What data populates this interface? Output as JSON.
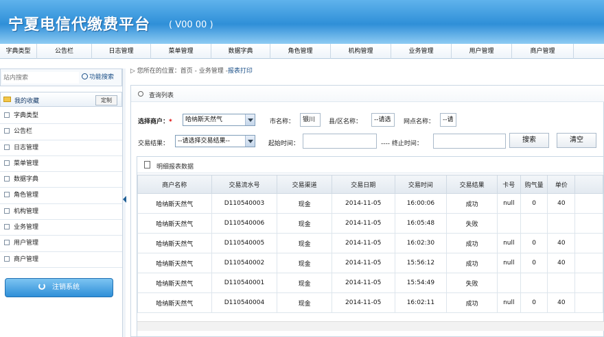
{
  "header": {
    "title": "宁夏电信代缴费平台",
    "version": "( V00 00 )"
  },
  "topnav": [
    "字典类型",
    "公告栏",
    "日志管理",
    "菜单管理",
    "数据字典",
    "角色管理",
    "机构管理",
    "业务管理",
    "用户管理",
    "商户管理"
  ],
  "sidebar": {
    "search_placeholder": "站内搜索",
    "search_button": "功能搜索",
    "favorites_label": "我的收藏",
    "define_button": "定制",
    "items": [
      "字典类型",
      "公告栏",
      "日志管理",
      "菜单管理",
      "数据字典",
      "角色管理",
      "机构管理",
      "业务管理",
      "用户管理",
      "商户管理"
    ],
    "logout_label": "注销系统"
  },
  "breadcrumb": {
    "prefix": "您所在的位置：首页 - 业务管理 -",
    "current": "报表打印"
  },
  "query": {
    "panel_title": "查询列表",
    "merchant_label": "选择商户：",
    "merchant_value": "哈纳斯天然气",
    "city_label": "市名称：",
    "city_value": "银川",
    "district_label": "县/区名称：",
    "district_value": "--请选",
    "outlet_label": "网点名称：",
    "outlet_value": "--请",
    "result_label": "交易结果：",
    "result_value": "--请选择交易结果--",
    "start_label": "起始时间：",
    "start_value": "",
    "end_label": "---- 终止时间：",
    "end_value": "",
    "search_button": "搜索",
    "clear_button": "清空"
  },
  "detail": {
    "title": "明细报表数据",
    "columns": [
      "商户名称",
      "交易流水号",
      "交易渠道",
      "交易日期",
      "交易时间",
      "交易结果",
      "卡号",
      "购气量",
      "单价",
      ""
    ],
    "rows": [
      [
        "哈纳斯天然气",
        "D110540003",
        "现金",
        "2014-11-05",
        "16:00:06",
        "成功",
        "null",
        "0",
        "40",
        ""
      ],
      [
        "哈纳斯天然气",
        "D110540006",
        "现金",
        "2014-11-05",
        "16:05:48",
        "失败",
        "",
        "",
        "",
        ""
      ],
      [
        "哈纳斯天然气",
        "D110540005",
        "现金",
        "2014-11-05",
        "16:02:30",
        "成功",
        "null",
        "0",
        "40",
        ""
      ],
      [
        "哈纳斯天然气",
        "D110540002",
        "现金",
        "2014-11-05",
        "15:56:12",
        "成功",
        "null",
        "0",
        "40",
        ""
      ],
      [
        "哈纳斯天然气",
        "D110540001",
        "现金",
        "2014-11-05",
        "15:54:49",
        "失败",
        "",
        "",
        "",
        ""
      ],
      [
        "哈纳斯天然气",
        "D110540004",
        "现金",
        "2014-11-05",
        "16:02:11",
        "成功",
        "null",
        "0",
        "40",
        ""
      ]
    ]
  }
}
